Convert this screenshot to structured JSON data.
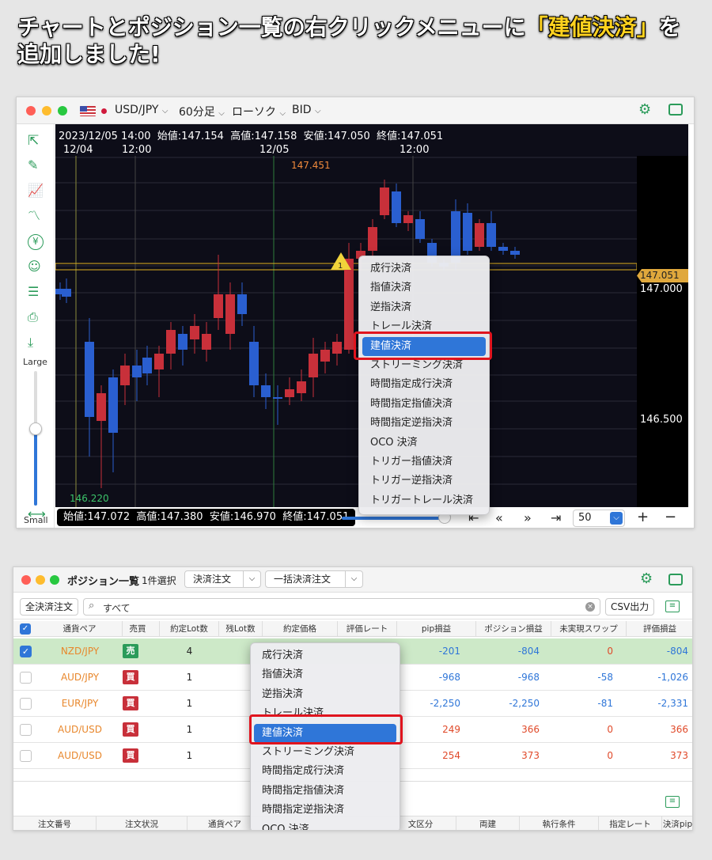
{
  "headline": {
    "part1": "チャートとポジション一覧の右クリックメニューに",
    "part2": "「建値決済」",
    "part3": "を追加しました!"
  },
  "chart_window": {
    "symbol": "USD/JPY",
    "timeframe": "60分足",
    "chart_type": "ローソク",
    "price_type": "BID",
    "ohlc_top": {
      "datetime": "2023/12/05 14:00",
      "open": "始値:147.154",
      "high": "高値:147.158",
      "low": "安値:147.050",
      "close": "終値:147.051"
    },
    "time_labels": [
      "12/04",
      "12:00",
      "12/05",
      "12:00"
    ],
    "price_high_label": "147.451",
    "price_low_label": "146.220",
    "current_price": "147.051",
    "axis_prices": [
      "147.000",
      "146.500"
    ],
    "marker": "1",
    "ohlc_bottom": {
      "open": "始値:147.072",
      "high": "高値:147.380",
      "low": "安値:146.970",
      "close": "終値:147.051"
    },
    "size_large": "Large",
    "size_small": "Small",
    "count_value": "50",
    "menu": [
      "成行決済",
      "指値決済",
      "逆指決済",
      "トレール決済",
      "建値決済",
      "ストリーミング決済",
      "時間指定成行決済",
      "時間指定指値決済",
      "時間指定逆指決済",
      "OCO 決済",
      "トリガー指値決済",
      "トリガー逆指決済",
      "トリガートレール決済"
    ],
    "selected_menu_index": 4
  },
  "position_window": {
    "title": "ポジション一覧",
    "selection": "1件選択",
    "btn_settle": "決済注文",
    "btn_bulk": "一括決済注文",
    "btn_all": "全決済注文",
    "search_placeholder": "すべて",
    "btn_csv": "CSV出力",
    "columns": [
      "通貨ペア",
      "売買",
      "約定Lot数",
      "残Lot数",
      "約定価格",
      "評価レート",
      "pip損益",
      "ポジション損益",
      "未実現スワップ",
      "評価損益"
    ],
    "rows": [
      {
        "pair": "NZD/JPY",
        "side": "売",
        "lot": "4",
        "pip": "-201",
        "pl": "-804",
        "swap": "0",
        "eval": "-804",
        "checked": true
      },
      {
        "pair": "AUD/JPY",
        "side": "買",
        "lot": "1",
        "pip": "-968",
        "pl": "-968",
        "swap": "-58",
        "eval": "-1,026",
        "checked": false
      },
      {
        "pair": "EUR/JPY",
        "side": "買",
        "lot": "1",
        "pip": "-2,250",
        "pl": "-2,250",
        "swap": "-81",
        "eval": "-2,331",
        "checked": false
      },
      {
        "pair": "AUD/USD",
        "side": "買",
        "lot": "1",
        "pip": "249",
        "pl": "366",
        "swap": "0",
        "eval": "366",
        "checked": false
      },
      {
        "pair": "AUD/USD",
        "side": "買",
        "lot": "1",
        "pip": "254",
        "pl": "373",
        "swap": "0",
        "eval": "373",
        "checked": false
      }
    ],
    "order_columns": [
      "注文番号",
      "注文状況",
      "通貨ペア",
      "文区分",
      "両建",
      "執行条件",
      "指定レート",
      "決済pip差"
    ],
    "menu": [
      "成行決済",
      "指値決済",
      "逆指決済",
      "トレール決済",
      "建値決済",
      "ストリーミング決済",
      "時間指定成行決済",
      "時間指定指値決済",
      "時間指定逆指決済",
      "OCO 決済"
    ],
    "selected_menu_index": 4
  },
  "colors": {
    "bull": "#c8303a",
    "bear": "#2a5fd0",
    "accent": "#2f76d8",
    "highlight": "#e0141e",
    "green": "#2b9b5a"
  }
}
